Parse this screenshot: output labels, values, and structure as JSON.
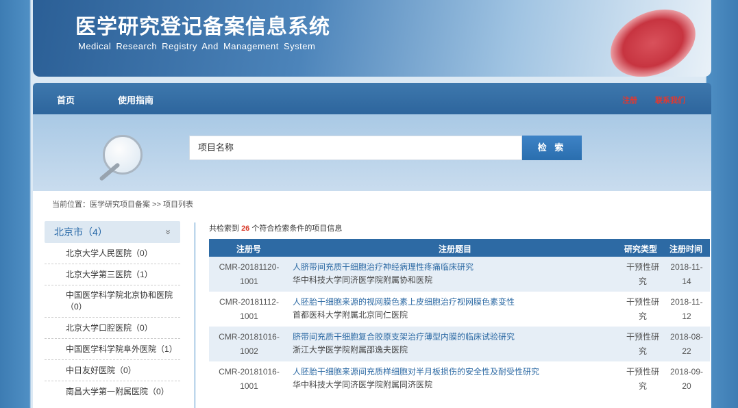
{
  "header": {
    "title_cn": "医学研究登记备案信息系统",
    "title_en": "Medical  Research  Registry  And  Management  System"
  },
  "nav": {
    "home": "首页",
    "guide": "使用指南",
    "register": "注册",
    "contact": "联系我们"
  },
  "search": {
    "placeholder": "项目名称",
    "button": "检 索"
  },
  "breadcrumb": "当前位置：医学研究项目备案 >> 项目列表",
  "sidebar": {
    "region": "北京市（4）",
    "chevron": "»",
    "items": [
      "北京大学人民医院（0）",
      "北京大学第三医院（1）",
      "中国医学科学院北京协和医院（0）",
      "北京大学口腔医院（0）",
      "中国医学科学院阜外医院（1）",
      "中日友好医院（0）",
      "南昌大学第一附属医院（0）"
    ]
  },
  "results": {
    "prefix": "共检索到",
    "count": "26",
    "suffix": "个符合检索条件的项目信息",
    "headers": {
      "id": "注册号",
      "title": "注册题目",
      "type": "研究类型",
      "date": "注册时间"
    },
    "rows": [
      {
        "id_a": "CMR-20181120-",
        "id_b": "1001",
        "title": "人脐带间充质干细胞治疗神经病理性疼痛临床研究",
        "inst": "华中科技大学同济医学院附属协和医院",
        "type_a": "干预性研",
        "type_b": "究",
        "date_a": "2018-11-",
        "date_b": "14"
      },
      {
        "id_a": "CMR-20181112-",
        "id_b": "1001",
        "title": "人胚胎干细胞来源的视网膜色素上皮细胞治疗视网膜色素变性",
        "inst": "首都医科大学附属北京同仁医院",
        "type_a": "干预性研",
        "type_b": "究",
        "date_a": "2018-11-",
        "date_b": "12"
      },
      {
        "id_a": "CMR-20181016-",
        "id_b": "1002",
        "title": "脐带间充质干细胞复合胶原支架治疗薄型内膜的临床试验研究",
        "inst": "浙江大学医学院附属邵逸夫医院",
        "type_a": "干预性研",
        "type_b": "究",
        "date_a": "2018-08-",
        "date_b": "22"
      },
      {
        "id_a": "CMR-20181016-",
        "id_b": "1001",
        "title": "人胚胎干细胞来源间充质样细胞对半月板损伤的安全性及耐受性研究",
        "inst": "华中科技大学同济医学院附属同济医院",
        "type_a": "干预性研",
        "type_b": "究",
        "date_a": "2018-09-",
        "date_b": "20"
      }
    ]
  }
}
